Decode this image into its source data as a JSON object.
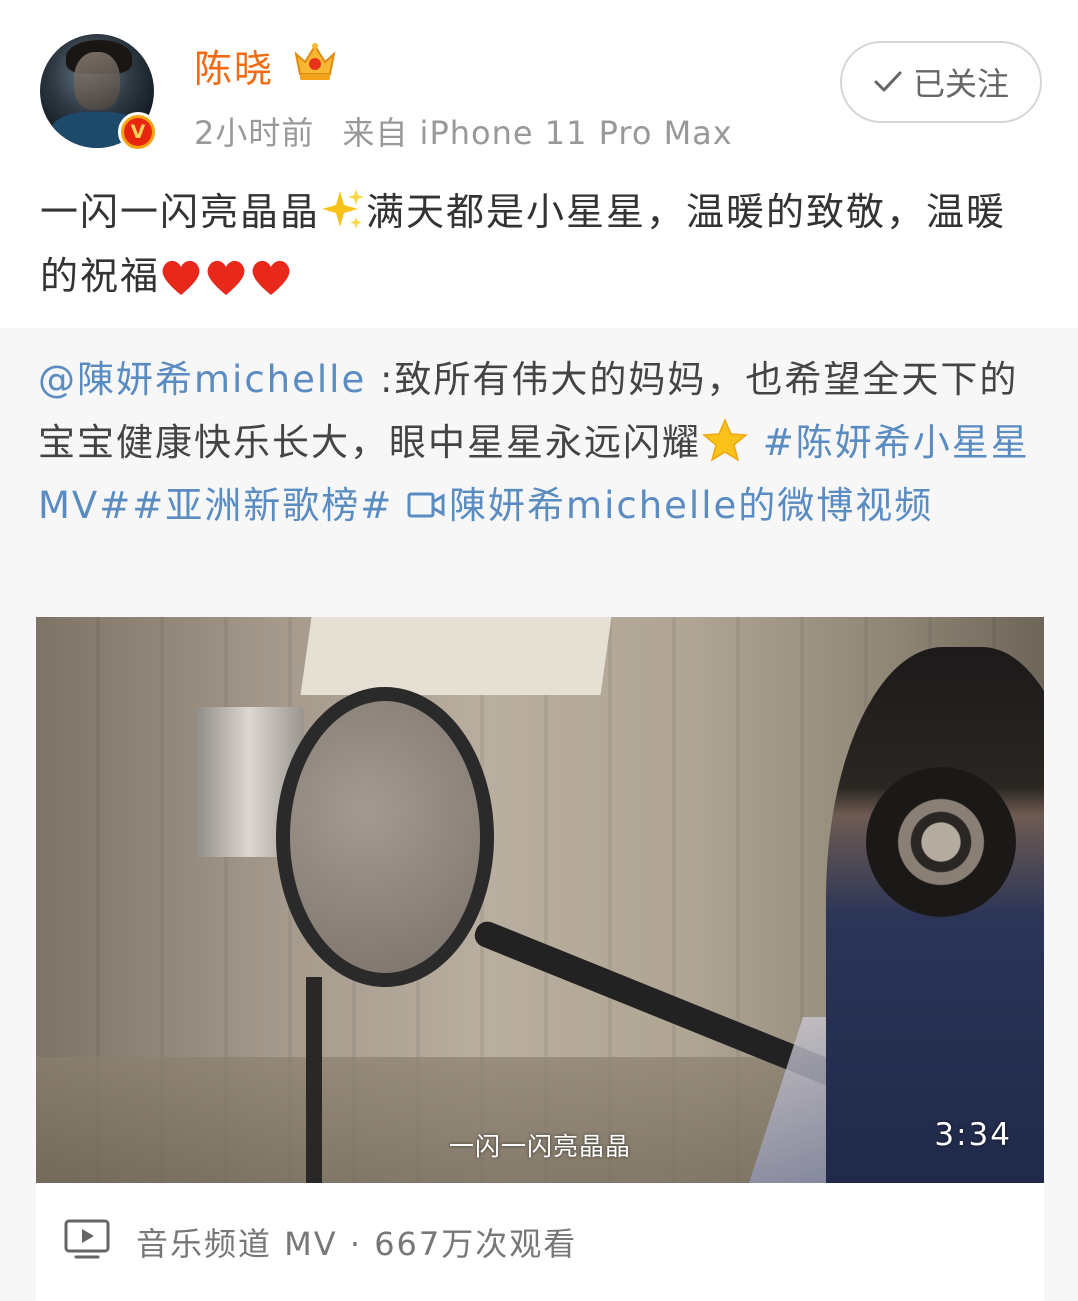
{
  "post": {
    "username": "陈晓",
    "time": "2小时前",
    "source": "来自 iPhone 11 Pro Max",
    "follow_label": "已关注",
    "text_part1": "一闪一闪亮晶晶",
    "text_part2": "满天都是小星星，温暖的致敬，温暖的祝福",
    "emojis": [
      "sparkles",
      "red-heart",
      "red-heart",
      "red-heart"
    ]
  },
  "repost": {
    "mention": "@陳妍希michelle",
    "text": ":致所有伟大的妈妈，也希望全天下的宝宝健康快乐长大，眼中星星永远闪耀",
    "emoji": "star",
    "hashtag1": "#陈妍希小星星MV#",
    "hashtag2": "#亚洲新歌榜#",
    "video_link": "陳妍希michelle的微博视频"
  },
  "video": {
    "subtitle": "一闪一闪亮晶晶",
    "duration": "3:34",
    "footer": "音乐频道 MV · 667万次观看"
  },
  "colors": {
    "username": "#f26b12",
    "link": "#5a8cc2",
    "verified_badge": "#f6a310"
  },
  "icons": [
    "verified-badge-icon",
    "crown-icon",
    "checkmark-icon",
    "video-camera-icon",
    "play-icon"
  ]
}
